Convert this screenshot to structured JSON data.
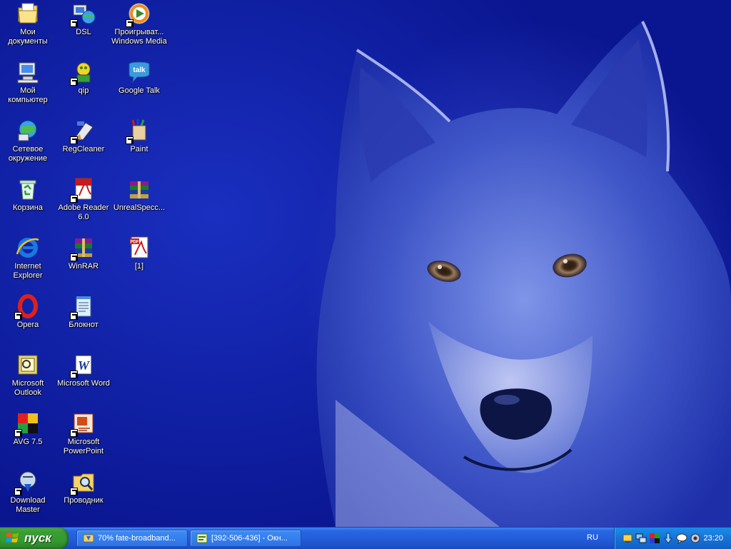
{
  "desktop": {
    "icons": [
      {
        "label": "Мои\nдокументы",
        "icon": "my-documents-icon",
        "shortcut": false
      },
      {
        "label": "Мой\nкомпьютер",
        "icon": "my-computer-icon",
        "shortcut": false
      },
      {
        "label": "Сетевое\nокружение",
        "icon": "network-places-icon",
        "shortcut": false
      },
      {
        "label": "Корзина",
        "icon": "recycle-bin-icon",
        "shortcut": false
      },
      {
        "label": "Internet\nExplorer",
        "icon": "internet-explorer-icon",
        "shortcut": false
      },
      {
        "label": "Opera",
        "icon": "opera-icon",
        "shortcut": true
      },
      {
        "label": "Microsoft\nOutlook",
        "icon": "outlook-icon",
        "shortcut": false
      },
      {
        "label": "AVG 7.5",
        "icon": "avg-icon",
        "shortcut": true
      },
      {
        "label": "Download\nMaster",
        "icon": "download-master-icon",
        "shortcut": true
      },
      {
        "label": "DSL",
        "icon": "dsl-connection-icon",
        "shortcut": true
      },
      {
        "label": "qip",
        "icon": "qip-icon",
        "shortcut": true
      },
      {
        "label": "RegCleaner",
        "icon": "regcleaner-icon",
        "shortcut": true
      },
      {
        "label": "Adobe Reader\n6.0",
        "icon": "adobe-reader-icon",
        "shortcut": true
      },
      {
        "label": "WinRAR",
        "icon": "winrar-icon",
        "shortcut": true
      },
      {
        "label": "Блокнот",
        "icon": "notepad-icon",
        "shortcut": true
      },
      {
        "label": "Microsoft Word",
        "icon": "word-icon",
        "shortcut": true
      },
      {
        "label": "Microsoft\nPowerPoint",
        "icon": "powerpoint-icon",
        "shortcut": true
      },
      {
        "label": "Проводник",
        "icon": "explorer-icon",
        "shortcut": true
      },
      {
        "label": "Проигрыват...\nWindows Media",
        "icon": "windows-media-player-icon",
        "shortcut": true
      },
      {
        "label": "Google Talk",
        "icon": "google-talk-icon",
        "shortcut": false
      },
      {
        "label": "Paint",
        "icon": "paint-icon",
        "shortcut": true
      },
      {
        "label": "UnrealSpecc...",
        "icon": "winrar-archive-icon",
        "shortcut": false
      },
      {
        "label": "[1]",
        "icon": "pdf-file-icon",
        "shortcut": false
      }
    ]
  },
  "taskbar": {
    "start_label": "пуск",
    "tasks": [
      {
        "label": "70% fate-broadband...",
        "icon": "download-progress-icon"
      },
      {
        "label": "[392-506-436] - Окн...",
        "icon": "chat-window-icon"
      }
    ],
    "language": "RU",
    "tray_icons": [
      "tray-network-icon",
      "tray-monitor-icon",
      "tray-colors-icon",
      "tray-download-icon",
      "tray-chat-icon",
      "tray-speaker-icon"
    ],
    "clock": "23:20"
  },
  "colors": {
    "desktop_bg": "#0b1fa6",
    "taskbar": "#245edb",
    "start_button": "#339b2f",
    "tray": "#1572d8"
  }
}
